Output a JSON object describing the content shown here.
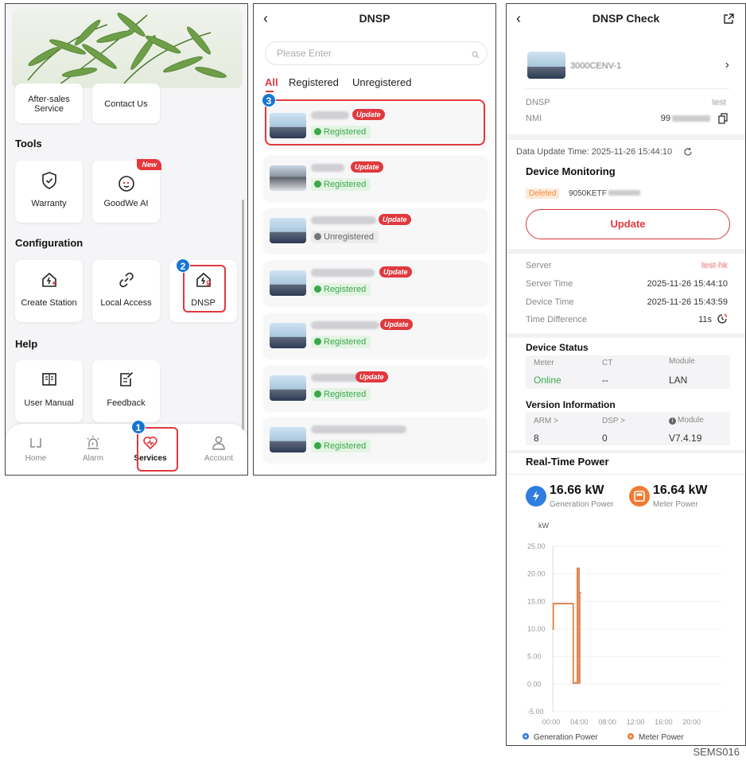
{
  "panel1": {
    "tiles_top": {
      "after_sales": "After-sales\nService",
      "contact": "Contact Us"
    },
    "sections": {
      "tools": "Tools",
      "configuration": "Configuration",
      "help": "Help"
    },
    "tools": [
      {
        "label": "Warranty"
      },
      {
        "label": "GoodWe AI",
        "badge": "New"
      }
    ],
    "configuration": [
      {
        "label": "Create Station"
      },
      {
        "label": "Local Access"
      },
      {
        "label": "DNSP"
      }
    ],
    "help": [
      {
        "label": "User Manual"
      },
      {
        "label": "Feedback"
      }
    ],
    "tabs": [
      {
        "label": "Home"
      },
      {
        "label": "Alarm"
      },
      {
        "label": "Services"
      },
      {
        "label": "Account"
      }
    ],
    "markers": {
      "one": "1",
      "two": "2"
    }
  },
  "panel2": {
    "title": "DNSP",
    "search_placeholder": "Please Enter",
    "filters": {
      "all": "All",
      "registered": "Registered",
      "unregistered": "Unregistered"
    },
    "marker": "3",
    "cards": [
      {
        "update": "Update",
        "status": "Registered"
      },
      {
        "update": "Update",
        "status": "Registered"
      },
      {
        "update": "Update",
        "status": "Unregistered"
      },
      {
        "update": "Update",
        "status": "Registered"
      },
      {
        "update": "Update",
        "status": "Registered"
      },
      {
        "update": "Update",
        "status": "Registered"
      },
      {
        "update": "",
        "status": "Registered"
      }
    ]
  },
  "panel3": {
    "title": "DNSP Check",
    "station_name": "3000CENV-1",
    "dnsp_label": "DNSP",
    "dnsp_value": "test",
    "nmi_label": "NMI",
    "nmi_value": "99",
    "data_update_time": "Data Update Time: 2025-11-26 15:44:10",
    "device_monitoring": "Device Monitoring",
    "deleted_tag": "Deleted",
    "device_sn": "9050KETF",
    "update_button": "Update",
    "server_label": "Server",
    "server_value": "test-hk",
    "server_time_label": "Server Time",
    "server_time_value": "2025-11-26 15:44:10",
    "device_time_label": "Device Time",
    "device_time_value": "2025-11-26 15:43:59",
    "time_diff_label": "Time Difference",
    "time_diff_value": "11s",
    "device_status": "Device Status",
    "status_headers": {
      "meter": "Meter",
      "ct": "CT",
      "module": "Module"
    },
    "status_values": {
      "meter": "Online",
      "ct": "--",
      "module": "LAN"
    },
    "version_info": "Version Information",
    "version_headers": {
      "arm": "ARM >",
      "dsp": "DSP >",
      "module": "Module"
    },
    "version_values": {
      "arm": "8",
      "dsp": "0",
      "module": "V7.4.19"
    },
    "realtime_power": "Real-Time Power",
    "generation_value": "16.66 kW",
    "generation_label": "Generation Power",
    "meter_value": "16.64 kW",
    "meter_label": "Meter Power",
    "colors": {
      "generation": "#2f7de1",
      "meter": "#f07b32"
    }
  },
  "chart_data": {
    "type": "line",
    "title": "",
    "ylabel": "kW",
    "xlabel": "",
    "ylim": [
      -5,
      25
    ],
    "yticks": [
      "25.00",
      "20.00",
      "15.00",
      "10.00",
      "5.00",
      "0.00",
      "-5.00"
    ],
    "xticks": [
      "00:00",
      "04:00",
      "08:00",
      "12:00",
      "16:00",
      "20:00"
    ],
    "xlim": [
      "00:00",
      "24:00"
    ],
    "series": [
      {
        "name": "Generation Power",
        "color": "#2f7de1",
        "x": [
          "00:00",
          "00:05",
          "00:20",
          "02:50",
          "02:55",
          "03:30",
          "03:45",
          "03:50",
          "04:00"
        ],
        "y": [
          10.0,
          14.6,
          14.6,
          14.6,
          0.2,
          21.0,
          0.2,
          16.6,
          16.6
        ]
      },
      {
        "name": "Meter Power",
        "color": "#f07b32",
        "x": [
          "00:00",
          "00:05",
          "00:20",
          "02:50",
          "02:55",
          "03:30",
          "03:45",
          "03:50",
          "04:00"
        ],
        "y": [
          10.0,
          14.6,
          14.6,
          14.6,
          0.2,
          21.0,
          0.2,
          16.6,
          16.6
        ]
      }
    ]
  },
  "watermark": "SEMS016"
}
